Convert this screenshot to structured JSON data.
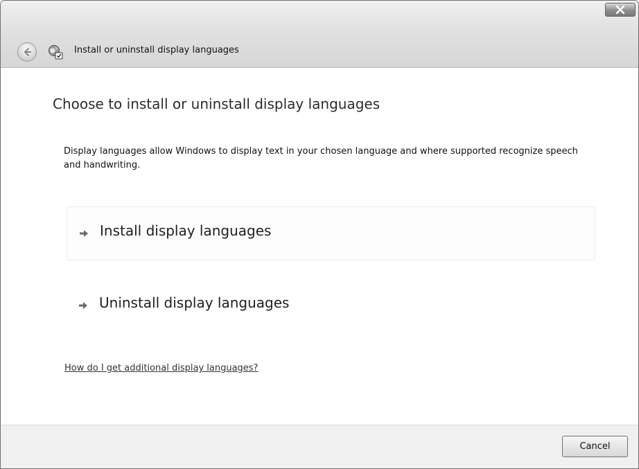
{
  "window": {
    "title": "Install or uninstall display languages"
  },
  "icons": {
    "close": "close-icon",
    "back": "back-arrow-icon",
    "app": "language-globe-icon",
    "option_arrow": "arrow-right-icon"
  },
  "main": {
    "heading": "Choose to install or uninstall display languages",
    "description": "Display languages allow Windows to display text in your chosen language and where supported recognize speech and handwriting.",
    "options": [
      {
        "label": "Install display languages"
      },
      {
        "label": "Uninstall display languages"
      }
    ],
    "help_link": "How do I get additional display languages?"
  },
  "footer": {
    "cancel_label": "Cancel"
  },
  "colors": {
    "titlebar_top": "#f1f1f1",
    "titlebar_bottom": "#d6d6d6",
    "footer_bg": "#f0f0f0",
    "text": "#1a1a1a"
  }
}
